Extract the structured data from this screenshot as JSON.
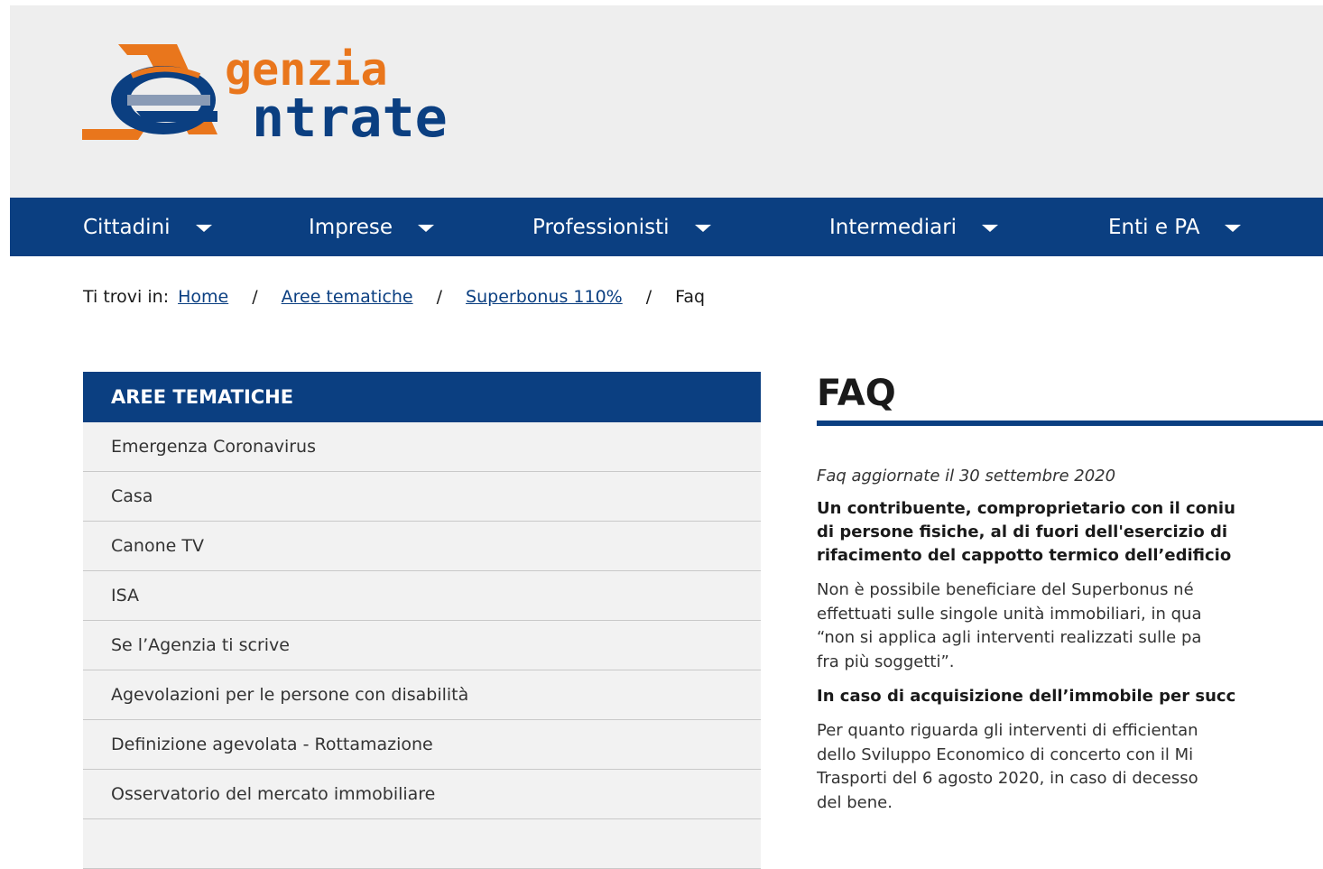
{
  "logo": {
    "line1": "genzia",
    "line2": "ntrate",
    "colors": {
      "orange": "#e9761c",
      "blue": "#0b3f81"
    }
  },
  "nav": {
    "items": [
      {
        "label": "Cittadini"
      },
      {
        "label": "Imprese"
      },
      {
        "label": "Professionisti"
      },
      {
        "label": "Intermediari"
      },
      {
        "label": "Enti e PA"
      }
    ],
    "caret_icon": "caret-down-icon",
    "bg_color": "#0b3f81"
  },
  "breadcrumb": {
    "prefix": "Ti trovi in:",
    "items": [
      {
        "label": "Home"
      },
      {
        "label": "Aree tematiche"
      },
      {
        "label": "Superbonus 110%"
      },
      {
        "label": "Faq"
      }
    ],
    "separator": "/"
  },
  "sidebar": {
    "title": "AREE TEMATICHE",
    "items": [
      {
        "label": "Emergenza Coronavirus"
      },
      {
        "label": "Casa"
      },
      {
        "label": "Canone TV"
      },
      {
        "label": "ISA"
      },
      {
        "label": "Se l’Agenzia ti scrive"
      },
      {
        "label": "Agevolazioni per le persone con disabilità"
      },
      {
        "label": "Definizione agevolata - Rottamazione"
      },
      {
        "label": "Osservatorio del mercato immobiliare"
      }
    ]
  },
  "main": {
    "title": "FAQ",
    "updated": "Faq aggiornate il 30 settembre 2020",
    "q1": [
      "Un contribuente, comproprietario con il coniu",
      "di persone fisiche, al di fuori dell'esercizio di",
      "rifacimento del cappotto termico dell’edificio"
    ],
    "a1": [
      "Non è possibile beneficiare del Superbonus né",
      "effettuati sulle singole unità immobiliari, in qua",
      "“non si applica agli interventi realizzati sulle pa",
      "fra più soggetti”."
    ],
    "q2": "In caso di acquisizione dell’immobile per succ",
    "a2": [
      "Per quanto riguarda gli interventi di efficientan",
      "dello Sviluppo Economico di concerto con il Mi",
      "Trasporti del 6 agosto 2020, in caso di decesso",
      "del bene."
    ]
  }
}
